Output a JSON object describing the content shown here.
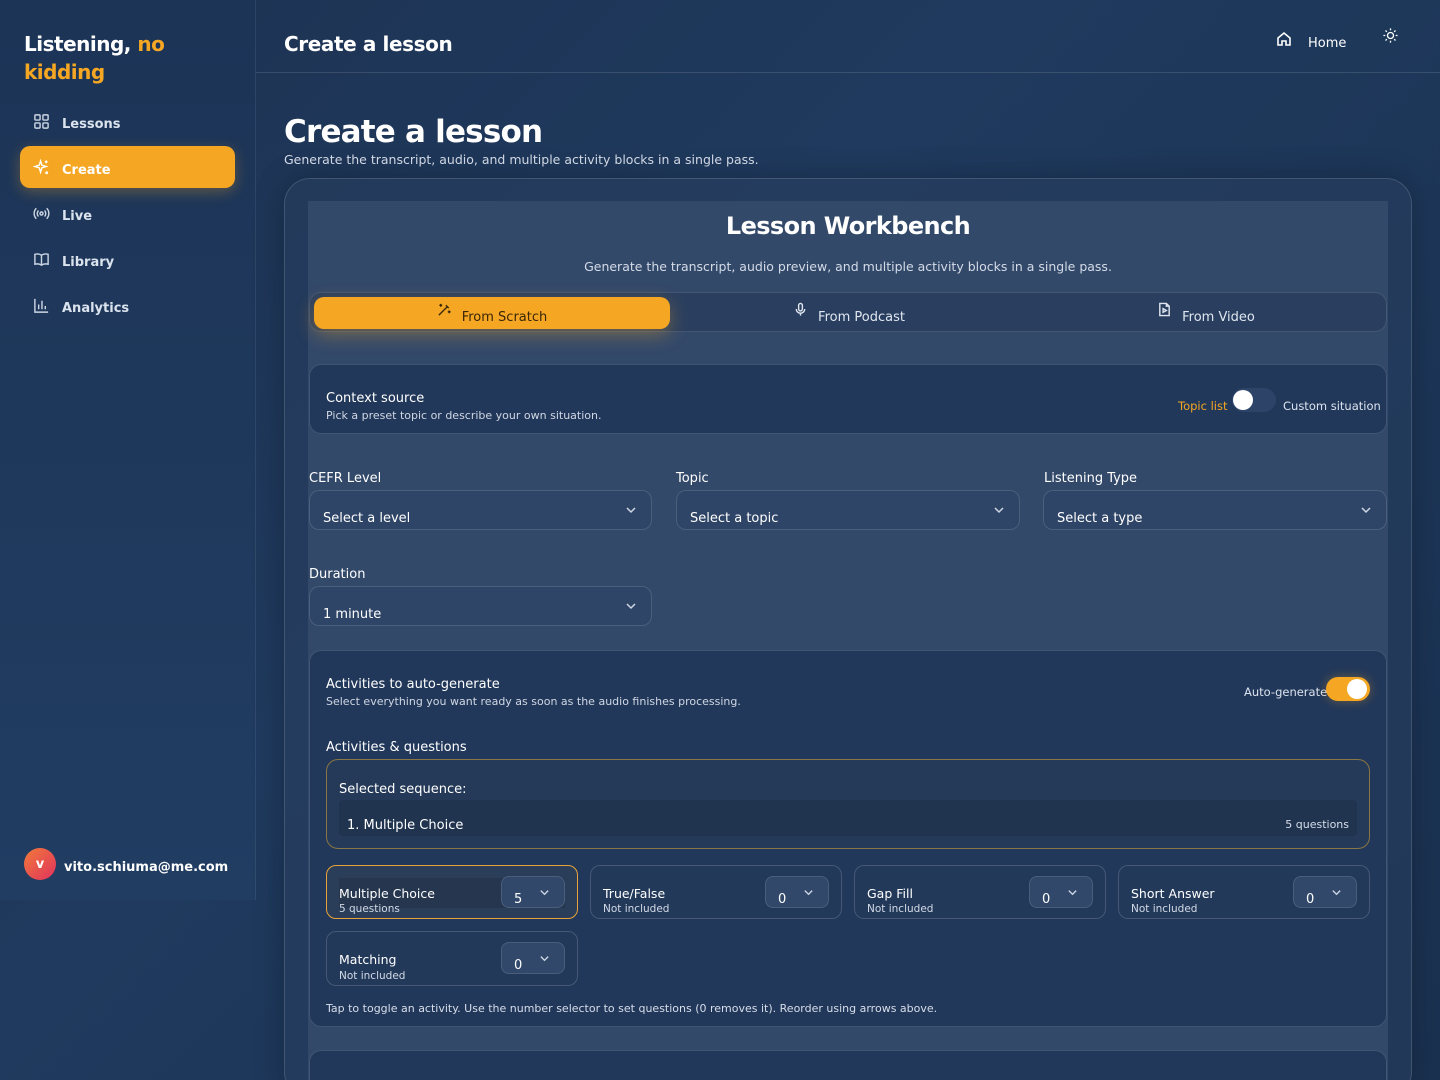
{
  "app": {
    "brand_part1": "Listening,",
    "brand_part2": "no",
    "brand_part3": "kidding",
    "accent_color": "#f5a623"
  },
  "sidebar": {
    "items": [
      {
        "label": "Lessons",
        "icon": "grid-icon"
      },
      {
        "label": "Create",
        "icon": "sparkle-icon",
        "active": true
      },
      {
        "label": "Live",
        "icon": "broadcast-icon"
      },
      {
        "label": "Library",
        "icon": "book-icon"
      },
      {
        "label": "Analytics",
        "icon": "bar-chart-icon"
      }
    ],
    "user": {
      "avatar_letter": "v",
      "email": "vito.schiuma@me.com"
    }
  },
  "header": {
    "title": "Create a lesson",
    "home_label": "Home",
    "theme_icon": "sun-icon"
  },
  "page": {
    "title": "Create a lesson",
    "subtitle": "Generate the transcript, audio, and multiple activity blocks in a single pass."
  },
  "workbench": {
    "title": "Lesson Workbench",
    "subtitle": "Generate the transcript, audio preview, and multiple activity blocks in a single pass.",
    "modes": [
      {
        "label": "From Scratch",
        "icon": "magic-wand-icon",
        "active": true
      },
      {
        "label": "From Podcast",
        "icon": "microphone-icon"
      },
      {
        "label": "From Video",
        "icon": "video-file-icon"
      }
    ]
  },
  "context": {
    "title": "Context source",
    "subtitle": "Pick a preset topic or describe your own situation.",
    "option_left": "Topic list",
    "option_right": "Custom situation",
    "custom_enabled": false
  },
  "fields": {
    "cefr": {
      "label": "CEFR Level",
      "value": "Select a level"
    },
    "topic": {
      "label": "Topic",
      "value": "Select a topic"
    },
    "listening_type": {
      "label": "Listening Type",
      "value": "Select a type"
    },
    "duration": {
      "label": "Duration",
      "value": "1 minute"
    }
  },
  "activities": {
    "title": "Activities to auto-generate",
    "subtitle": "Select everything you want ready as soon as the audio finishes processing.",
    "auto_label": "Auto-generate",
    "auto_enabled": true,
    "section_label": "Activities & questions",
    "sequence_label": "Selected sequence:",
    "sequence": [
      {
        "name": "1. Multiple Choice",
        "count": "5 questions"
      }
    ],
    "tiles": [
      {
        "name": "Multiple Choice",
        "status": "5 questions",
        "value": "5",
        "selected": true
      },
      {
        "name": "True/False",
        "status": "Not included",
        "value": "0",
        "selected": false
      },
      {
        "name": "Gap Fill",
        "status": "Not included",
        "value": "0",
        "selected": false
      },
      {
        "name": "Short Answer",
        "status": "Not included",
        "value": "0",
        "selected": false
      },
      {
        "name": "Matching",
        "status": "Not included",
        "value": "0",
        "selected": false
      }
    ],
    "hint": "Tap to toggle an activity. Use the number selector to set questions (0 removes it). Reorder using arrows above."
  }
}
